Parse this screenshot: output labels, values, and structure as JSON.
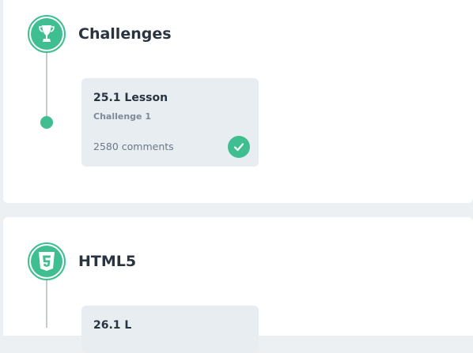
{
  "sections": [
    {
      "title": "Challenges",
      "icon": "trophy-icon",
      "cards": [
        {
          "title": "25.1 Lesson",
          "subtitle": "Challenge 1",
          "comments": "2580 comments",
          "completed": true
        }
      ]
    },
    {
      "title": "HTML5",
      "icon": "html5-icon",
      "cards": [
        {
          "title": "26.1 L"
        }
      ]
    }
  ],
  "colors": {
    "accent": "#3fbf91",
    "card_bg": "#e8edf2",
    "text_dark": "#2a3340",
    "text_muted": "#7d8a99",
    "page_bg": "#edf0f3"
  }
}
